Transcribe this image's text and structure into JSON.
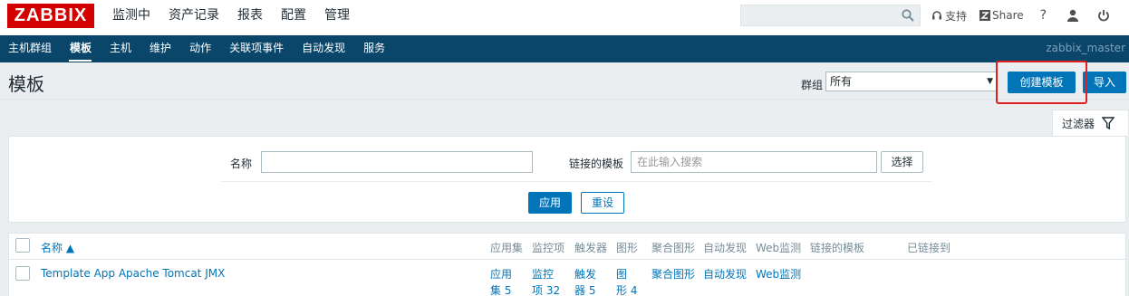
{
  "topbar": {
    "logo": "ZABBIX",
    "menu": [
      "监测中",
      "资产记录",
      "报表",
      "配置",
      "管理"
    ],
    "active_menu": "配置",
    "support_label": "支持",
    "share_label": "Share",
    "help_label": "?"
  },
  "subnav": {
    "items": [
      "主机群组",
      "模板",
      "主机",
      "维护",
      "动作",
      "关联项事件",
      "自动发现",
      "服务"
    ],
    "active": "模板",
    "server_name": "zabbix_master"
  },
  "page": {
    "title": "模板",
    "group_label": "群组",
    "group_value": "所有",
    "create_button": "创建模板",
    "import_button": "导入"
  },
  "filter": {
    "tab_label": "过滤器",
    "name_label": "名称",
    "name_value": "",
    "linked_label": "链接的模板",
    "linked_placeholder": "在此输入搜索",
    "select_button": "选择",
    "apply_button": "应用",
    "reset_button": "重设"
  },
  "table": {
    "headers": {
      "name": "名称 ▲",
      "applications": "应用集",
      "items": "监控项",
      "triggers": "触发器",
      "graphs": "图形",
      "screens": "聚合图形",
      "discovery": "自动发现",
      "web": "Web监测",
      "linked_templates": "链接的模板",
      "linked_to": "已链接到"
    },
    "rows": [
      {
        "name": "Template App Apache Tomcat JMX",
        "applications_a": "应用",
        "applications_b": "集 5",
        "items_a": "监控",
        "items_b": "项 32",
        "triggers_a": "触发",
        "triggers_b": "器 5",
        "graphs_a": "图",
        "graphs_b": "形 4",
        "screens": "聚合图形",
        "discovery": "自动发现",
        "web": "Web监测"
      }
    ]
  },
  "colors": {
    "brand_red": "#d40000",
    "nav_blue": "#0a466a",
    "button_blue": "#0275b8",
    "highlight_red": "#e02020"
  }
}
